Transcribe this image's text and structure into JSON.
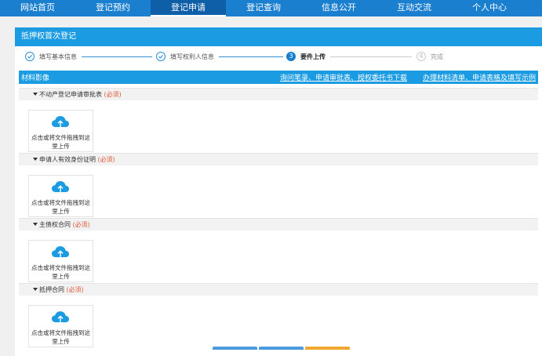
{
  "nav": {
    "items": [
      {
        "label": "网站首页"
      },
      {
        "label": "登记预约"
      },
      {
        "label": "登记申请"
      },
      {
        "label": "登记查询"
      },
      {
        "label": "信息公开"
      },
      {
        "label": "互动交流"
      },
      {
        "label": "个人中心"
      }
    ],
    "active_index": 2
  },
  "panel": {
    "title": "抵押权首次登记"
  },
  "steps": [
    {
      "number": "",
      "label": "填写基本信息",
      "state": "done",
      "icon": "check-icon"
    },
    {
      "number": "",
      "label": "填写权利人信息",
      "state": "done",
      "icon": "check-icon"
    },
    {
      "number": "3",
      "label": "要件上传",
      "state": "current"
    },
    {
      "number": "4",
      "label": "完成",
      "state": "todo"
    }
  ],
  "materials": {
    "title": "材料影像",
    "link_download": "询问笔录、申请审批表、授权委托书下载",
    "link_checklist": "办理材料清单、申请表格及填写示例"
  },
  "sections": [
    {
      "title": "不动产登记申请审批表",
      "required": "(必须)",
      "upload_text": "点击或将文件拖拽到这里上传"
    },
    {
      "title": "申请人有效身份证明",
      "required": "(必须)",
      "upload_text": "点击或将文件拖拽到这里上传"
    },
    {
      "title": "主债权合同",
      "required": "(必须)",
      "upload_text": "点击或将文件拖拽到这里上传"
    },
    {
      "title": "抵押合同",
      "required": "(必须)",
      "upload_text": "点击或将文件拖拽到这里上传"
    }
  ],
  "colors": {
    "nav_bg": "#1a7fcf",
    "accent": "#1a9be2",
    "required": "#e05a3a",
    "button_orange": "#f0a830"
  }
}
